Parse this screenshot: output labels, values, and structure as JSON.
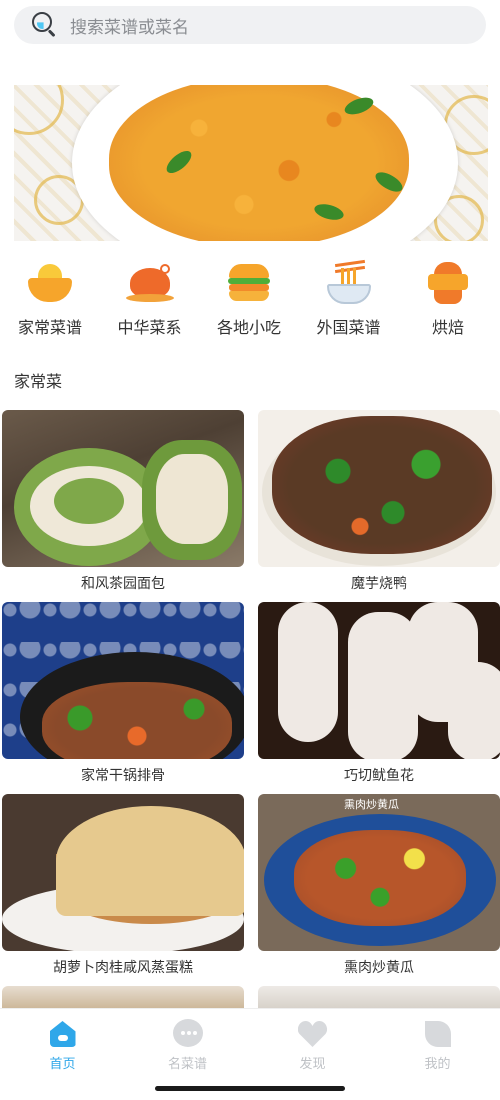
{
  "search": {
    "placeholder": "搜索菜谱或菜名"
  },
  "categories": [
    {
      "label": "家常菜谱",
      "icon": "bowl-icon"
    },
    {
      "label": "中华菜系",
      "icon": "roast-chicken-icon"
    },
    {
      "label": "各地小吃",
      "icon": "burger-icon"
    },
    {
      "label": "外国菜谱",
      "icon": "noodle-bowl-icon"
    },
    {
      "label": "烘焙",
      "icon": "cupcake-icon"
    }
  ],
  "section": {
    "title": "家常菜"
  },
  "recipes": [
    {
      "title": "和风茶园面包"
    },
    {
      "title": "魔芋烧鸭"
    },
    {
      "title": "家常干锅排骨"
    },
    {
      "title": "巧切鱿鱼花"
    },
    {
      "title": "胡萝卜肉桂咸风蒸蛋糕"
    },
    {
      "title": "熏肉炒黄瓜",
      "watermark": "熏肉炒黄瓜"
    }
  ],
  "nav": [
    {
      "label": "首页",
      "icon": "home-icon",
      "active": true
    },
    {
      "label": "名菜谱",
      "icon": "chat-bubble-icon",
      "active": false
    },
    {
      "label": "发现",
      "icon": "heart-icon",
      "active": false
    },
    {
      "label": "我的",
      "icon": "leaf-icon",
      "active": false
    }
  ],
  "colors": {
    "accent": "#2fa7e9",
    "inactive": "#bfc2c6",
    "search_bg": "#f0f1f3"
  }
}
